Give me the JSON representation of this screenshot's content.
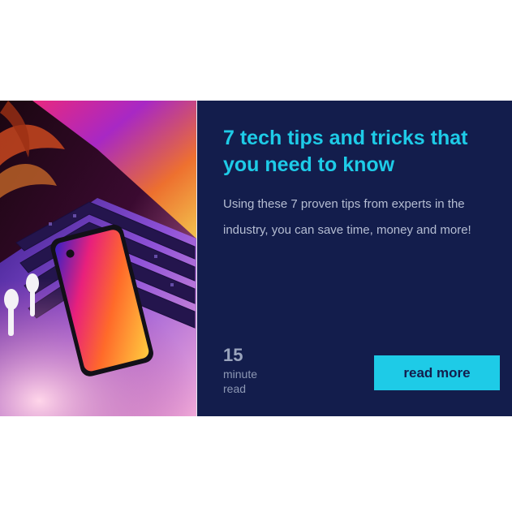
{
  "card": {
    "image_alt": "Laptop keyboard and smartphone lit by colorful neon light",
    "title": "7 tech tips and tricks that you need to know",
    "description": "Using these 7 proven tips from experts in the industry, you can save time, money and more!",
    "read_time": {
      "number": "15",
      "unit": "minute read"
    },
    "button_label": "read more"
  },
  "colors": {
    "panel_background": "#131d4c",
    "accent": "#1ecbe7",
    "description_text": "#b5bdd2",
    "muted_text": "#8c97b3",
    "page_background": "#ffffff"
  }
}
